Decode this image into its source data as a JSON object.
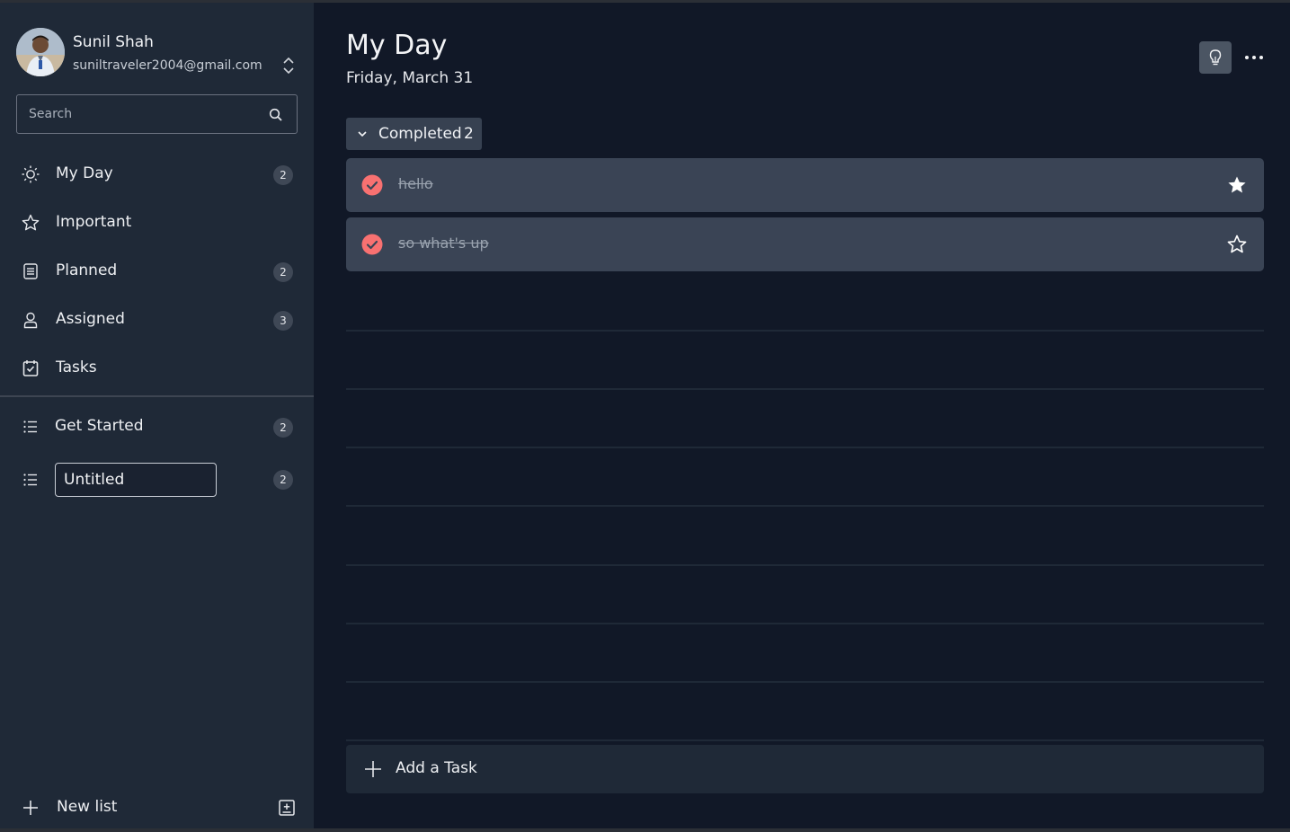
{
  "profile": {
    "name": "Sunil Shah",
    "email": "suniltraveler2004@gmail.com",
    "avatar_icon": "avatar-photo",
    "toggle_icon": "chevron-up-down-icon"
  },
  "search": {
    "placeholder": "Search",
    "icon": "search-icon"
  },
  "sidebar": {
    "smart_lists": [
      {
        "label": "My Day",
        "count": "2",
        "icon": "sun-icon"
      },
      {
        "label": "Important",
        "count": "",
        "icon": "star-icon"
      },
      {
        "label": "Planned",
        "count": "2",
        "icon": "planner-icon"
      },
      {
        "label": "Assigned",
        "count": "3",
        "icon": "person-icon"
      },
      {
        "label": "Tasks",
        "count": "",
        "icon": "check-box-icon"
      }
    ],
    "custom_lists": [
      {
        "label": "Get Started",
        "count": "2",
        "icon": "list-icon"
      },
      {
        "label": "Untitled",
        "count": "2",
        "icon": "list-icon",
        "editing": true
      }
    ],
    "new_list_label": "New list",
    "new_list_icon": "plus-icon",
    "new_group_icon": "add-group-icon"
  },
  "main": {
    "title": "My Day",
    "date": "Friday, March 31",
    "suggestions_icon": "lightbulb-icon",
    "more_icon": "ellipsis-icon",
    "completed": {
      "label": "Completed",
      "count": "2",
      "icon": "chevron-down-icon"
    },
    "tasks": [
      {
        "title": "hello",
        "completed": true,
        "starred": true
      },
      {
        "title": "so what's up",
        "completed": true,
        "starred": false
      }
    ],
    "add_task_label": "Add a Task",
    "add_task_icon": "plus-icon"
  },
  "colors": {
    "sidebar_bg": "#1f2937",
    "main_bg": "#111827",
    "task_bg": "#3a4455",
    "check_accent": "#f87171",
    "badge_bg": "#3f4856"
  }
}
